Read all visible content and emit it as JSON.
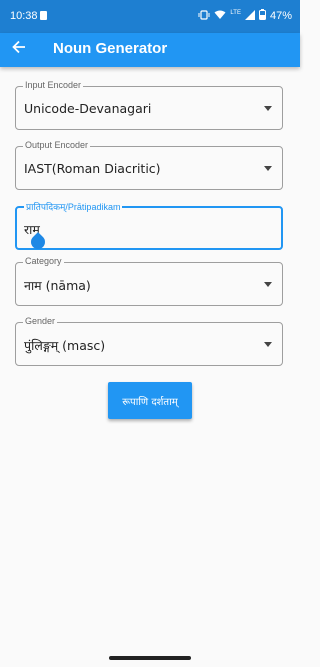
{
  "status_bar": {
    "time": "10:38",
    "signal_label": "LTE",
    "battery": "47%"
  },
  "app_bar": {
    "title": "Noun Generator",
    "back_icon": "arrow-left-icon"
  },
  "form": {
    "input_encoder": {
      "label": "Input Encoder",
      "value": "Unicode-Devanagari"
    },
    "output_encoder": {
      "label": "Output Encoder",
      "value": "IAST(Roman Diacritic)"
    },
    "pratipadikam": {
      "label": "प्रातिपदिकम्/Prātipadikam",
      "value": "राम"
    },
    "category": {
      "label": "Category",
      "value": "नाम (nāma)"
    },
    "gender": {
      "label": "Gender",
      "value": "पुंलिङ्गम् (masc)"
    }
  },
  "submit_button": {
    "label": "रूपाणि दर्शताम्"
  },
  "colors": {
    "primary": "#2196f3",
    "status_bar": "#1e7fd1",
    "background": "#fafafa"
  }
}
